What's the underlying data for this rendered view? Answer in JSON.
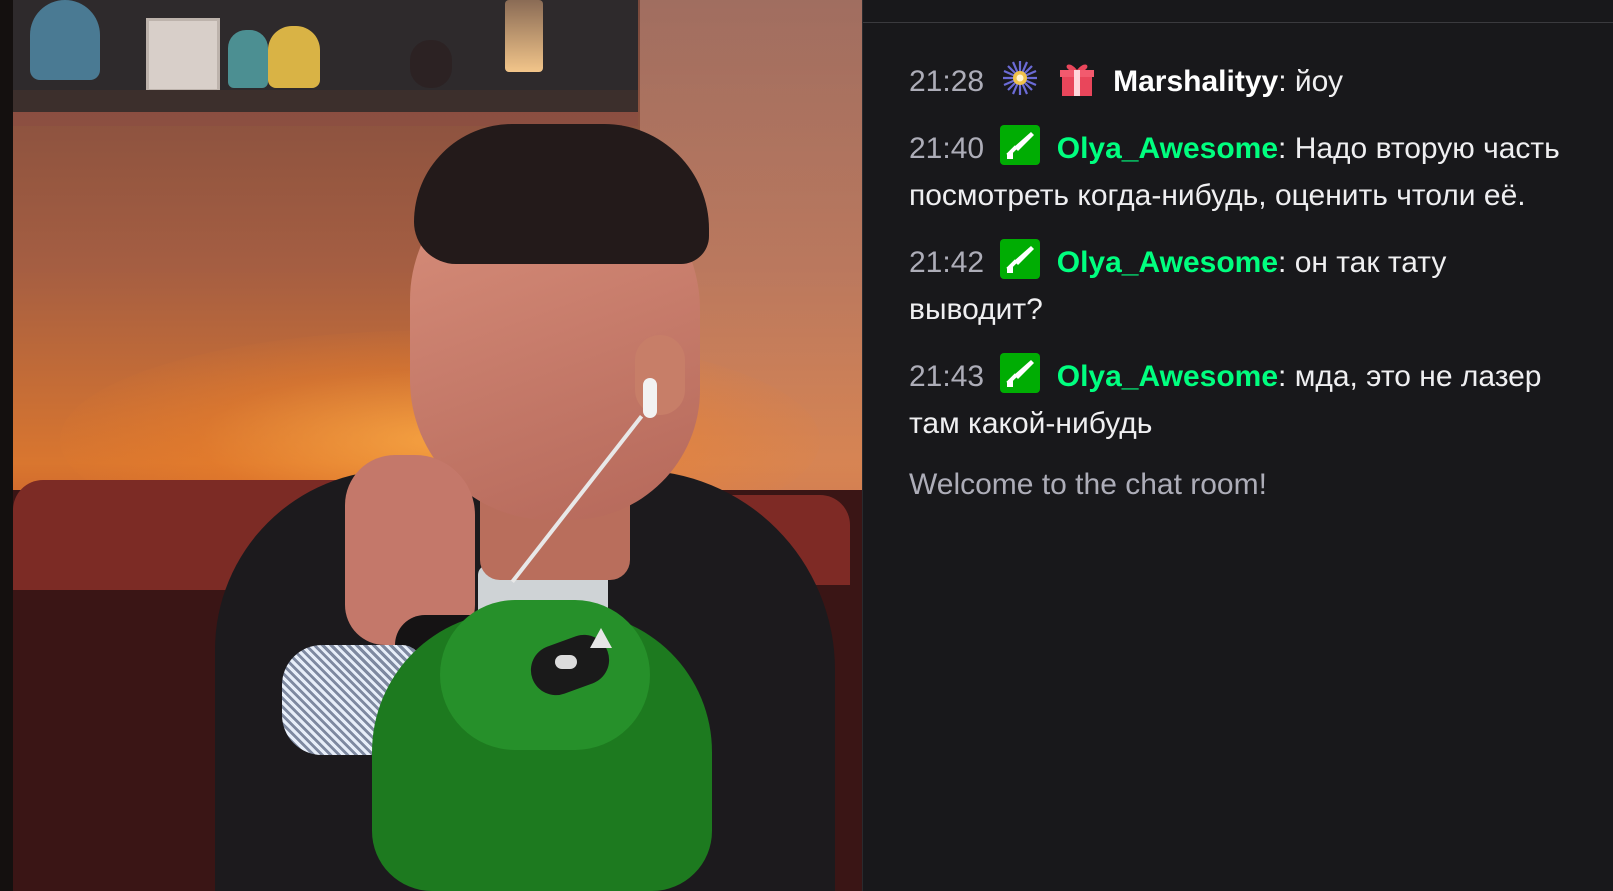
{
  "chat": {
    "messages": [
      {
        "time": "21:28",
        "badges": [
          "sun-badge-icon",
          "gift-badge-icon"
        ],
        "username": "Marshalityy",
        "username_color": "#ffffff",
        "separator": ":",
        "text": " йоу"
      },
      {
        "time": "21:40",
        "badges": [
          "moderator-sword-badge-icon"
        ],
        "username": "Olya_Awesome",
        "username_color": "#00ff7f",
        "separator": ":",
        "text": " Надо вторую часть посмотреть когда-нибудь, оценить чтоли её."
      },
      {
        "time": "21:42",
        "badges": [
          "moderator-sword-badge-icon"
        ],
        "username": "Olya_Awesome",
        "username_color": "#00ff7f",
        "separator": ":",
        "text": " он так тату выводит?"
      },
      {
        "time": "21:43",
        "badges": [
          "moderator-sword-badge-icon"
        ],
        "username": "Olya_Awesome",
        "username_color": "#00ff7f",
        "separator": ":",
        "text": " мда, это не лазер там какой-нибудь"
      }
    ],
    "welcome": "Welcome to the chat room!"
  },
  "colors": {
    "panel_bg": "#18181b",
    "timestamp": "#adadb8",
    "moderator_badge": "#00ad03",
    "gift_badge": "#e9465b"
  }
}
